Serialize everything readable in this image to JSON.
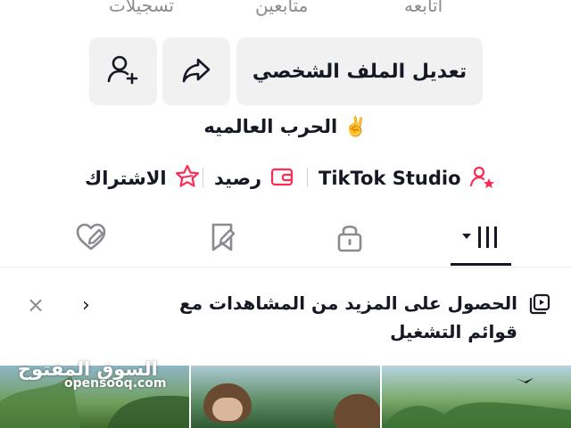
{
  "stats": {
    "recordings_label": "تسجيلات",
    "followers_label": "متابعين",
    "following_label": "أتابعه"
  },
  "actions": {
    "edit_profile_label": "تعديل الملف الشخصي",
    "share_icon": "share-arrow-icon",
    "add_friend_icon": "add-user-icon"
  },
  "bio": {
    "text": "الحرب العالميه ✌️"
  },
  "links": {
    "studio_label": "TikTok Studio",
    "balance_label": "رصيد",
    "subscription_label": "الاشتراك",
    "accent_color": "#fe2c55"
  },
  "tabs": [
    {
      "name": "videos",
      "icon": "grid-icon",
      "active": true
    },
    {
      "name": "private",
      "icon": "lock-icon",
      "active": false
    },
    {
      "name": "favorites",
      "icon": "bookmark-icon",
      "active": false
    },
    {
      "name": "liked",
      "icon": "heart-icon",
      "active": false
    }
  ],
  "banner": {
    "text": "الحصول على المزيد من المشاهدات مع قوائم التشغيل",
    "icon": "playlist-icon"
  },
  "watermark": {
    "arabic": "السوق المفتوح",
    "latin": "opensooq.com"
  }
}
